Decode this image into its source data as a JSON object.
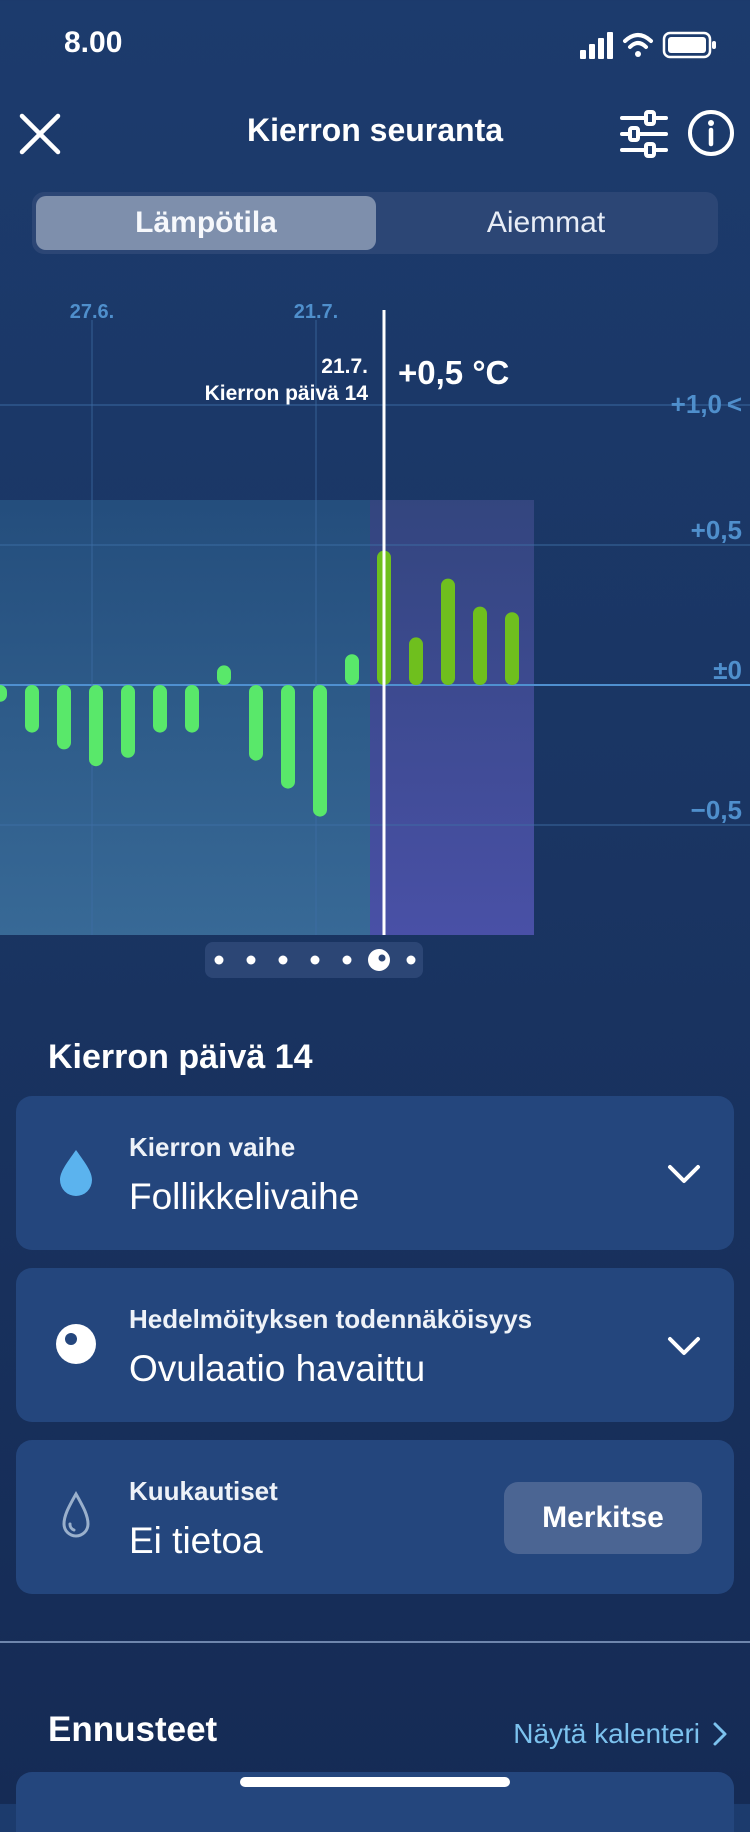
{
  "status_bar": {
    "time": "8.00"
  },
  "header": {
    "title": "Kierron seuranta"
  },
  "tabs": [
    {
      "label": "Lämpötila",
      "active": true
    },
    {
      "label": "Aiemmat",
      "active": false
    }
  ],
  "chart_data": {
    "type": "bar",
    "date_ticks": [
      "27.6.",
      "21.7."
    ],
    "y_ticks": [
      "+1,0",
      "+0,5",
      "±0",
      "−0,5"
    ],
    "ylim": [
      -0.9,
      1.0
    ],
    "values": [
      -0.06,
      -0.17,
      -0.23,
      -0.29,
      -0.26,
      -0.17,
      -0.17,
      0.07,
      -0.27,
      -0.37,
      -0.47,
      0.11,
      0.48,
      0.17,
      0.38,
      0.28,
      0.26
    ],
    "selected_index": 12,
    "selected": {
      "date": "21.7.",
      "day_label": "Kierron päivä 14",
      "value_label": "+0,5 °C"
    },
    "y_axis_marker": "<",
    "page_dots": 7,
    "page_active": 5,
    "colors": {
      "low": "#59e86a",
      "high": "#6fbf1e",
      "selected_band": "#444fa0",
      "grid": "#3f6fa7",
      "tick": "#4f8fcc"
    }
  },
  "section": {
    "title": "Kierron päivä 14"
  },
  "cards": [
    {
      "label": "Kierron vaihe",
      "value": "Follikkelivaihe",
      "icon": "drop-filled-icon"
    },
    {
      "label": "Hedelmöityksen todennäköisyys",
      "value": "Ovulaatio havaittu",
      "icon": "ovulation-circle-icon"
    },
    {
      "label": "Kuukautiset",
      "value": "Ei tietoa",
      "icon": "drop-outline-icon",
      "button": "Merkitse"
    }
  ],
  "forecast": {
    "title": "Ennusteet",
    "link": "Näytä kalenteri"
  }
}
